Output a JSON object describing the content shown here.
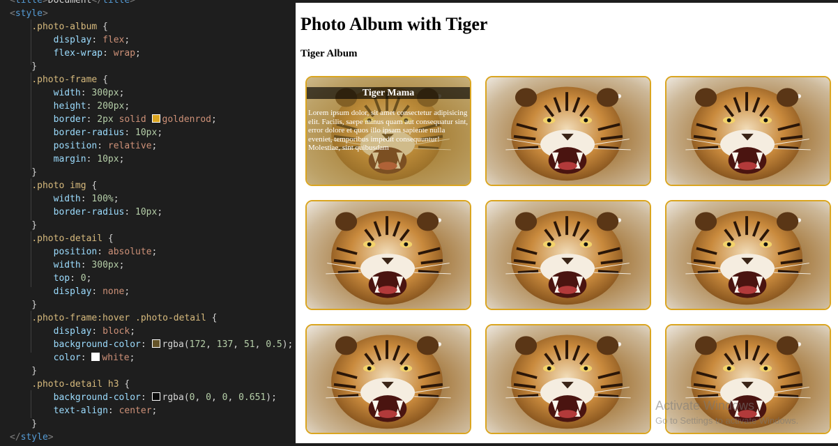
{
  "editor": {
    "lines": [
      [
        [
          "tag",
          "<"
        ],
        [
          "tagname",
          "title"
        ],
        [
          "tag",
          ">"
        ],
        [
          "punc",
          "Document"
        ],
        [
          "tag",
          "</"
        ],
        [
          "tagname",
          "title"
        ],
        [
          "tag",
          ">"
        ]
      ],
      [
        [
          "tag",
          "<"
        ],
        [
          "tagname",
          "style"
        ],
        [
          "tag",
          ">"
        ]
      ],
      [
        [
          "punc",
          "    "
        ],
        [
          "sel",
          ".photo-album"
        ],
        [
          "punc",
          " {"
        ]
      ],
      [
        [
          "punc",
          "        "
        ],
        [
          "prop",
          "display"
        ],
        [
          "punc",
          ": "
        ],
        [
          "val",
          "flex"
        ],
        [
          "punc",
          ";"
        ]
      ],
      [
        [
          "punc",
          "        "
        ],
        [
          "prop",
          "flex-wrap"
        ],
        [
          "punc",
          ": "
        ],
        [
          "val",
          "wrap"
        ],
        [
          "punc",
          ";"
        ]
      ],
      [
        [
          "punc",
          "    }"
        ]
      ],
      [
        [
          "punc",
          "    "
        ],
        [
          "sel",
          ".photo-frame"
        ],
        [
          "punc",
          " "
        ],
        [
          "brace",
          "{"
        ]
      ],
      [
        [
          "punc",
          "        "
        ],
        [
          "prop",
          "width"
        ],
        [
          "punc",
          ": "
        ],
        [
          "num",
          "300px"
        ],
        [
          "punc",
          ";"
        ]
      ],
      [
        [
          "punc",
          "        "
        ],
        [
          "prop",
          "height"
        ],
        [
          "punc",
          ": "
        ],
        [
          "num",
          "200px"
        ],
        [
          "punc",
          ";"
        ]
      ],
      [
        [
          "punc",
          "        "
        ],
        [
          "prop",
          "border"
        ],
        [
          "punc",
          ": "
        ],
        [
          "num",
          "2px"
        ],
        [
          "punc",
          " "
        ],
        [
          "val",
          "solid"
        ],
        [
          "punc",
          " "
        ],
        [
          "swatch",
          "goldenrod"
        ],
        [
          "val",
          "goldenrod"
        ],
        [
          "punc",
          ";"
        ]
      ],
      [
        [
          "punc",
          "        "
        ],
        [
          "prop",
          "border-radius"
        ],
        [
          "punc",
          ": "
        ],
        [
          "num",
          "10px"
        ],
        [
          "punc",
          ";"
        ]
      ],
      [
        [
          "punc",
          "        "
        ],
        [
          "prop",
          "position"
        ],
        [
          "punc",
          ": "
        ],
        [
          "val",
          "relative"
        ],
        [
          "punc",
          ";"
        ]
      ],
      [
        [
          "punc",
          "        "
        ],
        [
          "prop",
          "margin"
        ],
        [
          "punc",
          ": "
        ],
        [
          "num",
          "10px"
        ],
        [
          "punc",
          ";"
        ]
      ],
      [
        [
          "brace",
          "    }"
        ]
      ],
      [
        [
          "punc",
          "    "
        ],
        [
          "sel",
          ".photo img"
        ],
        [
          "punc",
          " {"
        ]
      ],
      [
        [
          "punc",
          "        "
        ],
        [
          "prop",
          "width"
        ],
        [
          "punc",
          ": "
        ],
        [
          "num",
          "100%"
        ],
        [
          "punc",
          ";"
        ]
      ],
      [
        [
          "punc",
          "        "
        ],
        [
          "prop",
          "border-radius"
        ],
        [
          "punc",
          ": "
        ],
        [
          "num",
          "10px"
        ],
        [
          "punc",
          ";"
        ]
      ],
      [
        [
          "punc",
          "    }"
        ]
      ],
      [
        [
          "punc",
          "    "
        ],
        [
          "sel",
          ".photo-detail"
        ],
        [
          "punc",
          " {"
        ]
      ],
      [
        [
          "punc",
          "        "
        ],
        [
          "prop",
          "position"
        ],
        [
          "punc",
          ": "
        ],
        [
          "val",
          "absolute"
        ],
        [
          "punc",
          ";"
        ]
      ],
      [
        [
          "punc",
          "        "
        ],
        [
          "prop",
          "width"
        ],
        [
          "punc",
          ": "
        ],
        [
          "num",
          "300px"
        ],
        [
          "punc",
          ";"
        ]
      ],
      [
        [
          "punc",
          "        "
        ],
        [
          "prop",
          "top"
        ],
        [
          "punc",
          ": "
        ],
        [
          "num",
          "0"
        ],
        [
          "punc",
          ";"
        ]
      ],
      [
        [
          "punc",
          "        "
        ],
        [
          "prop",
          "display"
        ],
        [
          "punc",
          ": "
        ],
        [
          "val",
          "none"
        ],
        [
          "punc",
          ";"
        ]
      ],
      [
        [
          "punc",
          "    }"
        ]
      ],
      [
        [
          "punc",
          "    "
        ],
        [
          "sel",
          ".photo-frame:hover .photo-detail"
        ],
        [
          "punc",
          " {"
        ]
      ],
      [
        [
          "punc",
          "        "
        ],
        [
          "prop",
          "display"
        ],
        [
          "punc",
          ": "
        ],
        [
          "val",
          "block"
        ],
        [
          "punc",
          ";"
        ]
      ],
      [
        [
          "punc",
          "        "
        ],
        [
          "prop",
          "background-color"
        ],
        [
          "punc",
          ": "
        ],
        [
          "swatch",
          "rgba(172, 137, 51, 0.5)"
        ],
        [
          "punc",
          "rgba("
        ],
        [
          "num",
          "172"
        ],
        [
          "punc",
          ", "
        ],
        [
          "num",
          "137"
        ],
        [
          "punc",
          ", "
        ],
        [
          "num",
          "51"
        ],
        [
          "punc",
          ", "
        ],
        [
          "num",
          "0.5"
        ],
        [
          "punc",
          ");"
        ]
      ],
      [
        [
          "punc",
          "        "
        ],
        [
          "prop",
          "color"
        ],
        [
          "punc",
          ": "
        ],
        [
          "swatch",
          "white"
        ],
        [
          "val",
          "white"
        ],
        [
          "punc",
          ";"
        ]
      ],
      [
        [
          "punc",
          "    }"
        ]
      ],
      [
        [
          "punc",
          "    "
        ],
        [
          "sel",
          ".photo-detail h3"
        ],
        [
          "punc",
          " {"
        ]
      ],
      [
        [
          "punc",
          "        "
        ],
        [
          "prop",
          "background-color"
        ],
        [
          "punc",
          ": "
        ],
        [
          "swatch",
          "rgba(0, 0, 0, 0.651)"
        ],
        [
          "punc",
          "rgba("
        ],
        [
          "num",
          "0"
        ],
        [
          "punc",
          ", "
        ],
        [
          "num",
          "0"
        ],
        [
          "punc",
          ", "
        ],
        [
          "num",
          "0"
        ],
        [
          "punc",
          ", "
        ],
        [
          "num",
          "0.651"
        ],
        [
          "punc",
          ");"
        ]
      ],
      [
        [
          "punc",
          "        "
        ],
        [
          "prop",
          "text-align"
        ],
        [
          "punc",
          ": "
        ],
        [
          "val",
          "center"
        ],
        [
          "punc",
          ";"
        ]
      ],
      [
        [
          "punc",
          "    }"
        ]
      ],
      [
        [
          "tag",
          "</"
        ],
        [
          "tagname",
          "style"
        ],
        [
          "tag",
          ">"
        ]
      ],
      [
        [
          "tag",
          "<"
        ],
        [
          "tagname",
          "/"
        ]
      ]
    ]
  },
  "preview": {
    "page_title": "Photo Album with Tiger",
    "album_title": "Tiger Album",
    "hover_detail": {
      "heading": "Tiger Mama",
      "text": "Lorem ipsum dolor, sit amet consectetur adipisicing elit. Facilis, saepe minus quam aut consequatur sint, error dolore et quos illo ipsam sapiente nulla eveniet, temporibus impedit consequuntur! Molestiae, sint quibusdam"
    },
    "photo_count": 9,
    "hovered_index": 0,
    "photo_icon": "tiger-photo",
    "frame_border_color": "#daa520"
  },
  "watermark": {
    "title": "Activate Windows",
    "subtitle": "Go to Settings to activate Windows."
  }
}
